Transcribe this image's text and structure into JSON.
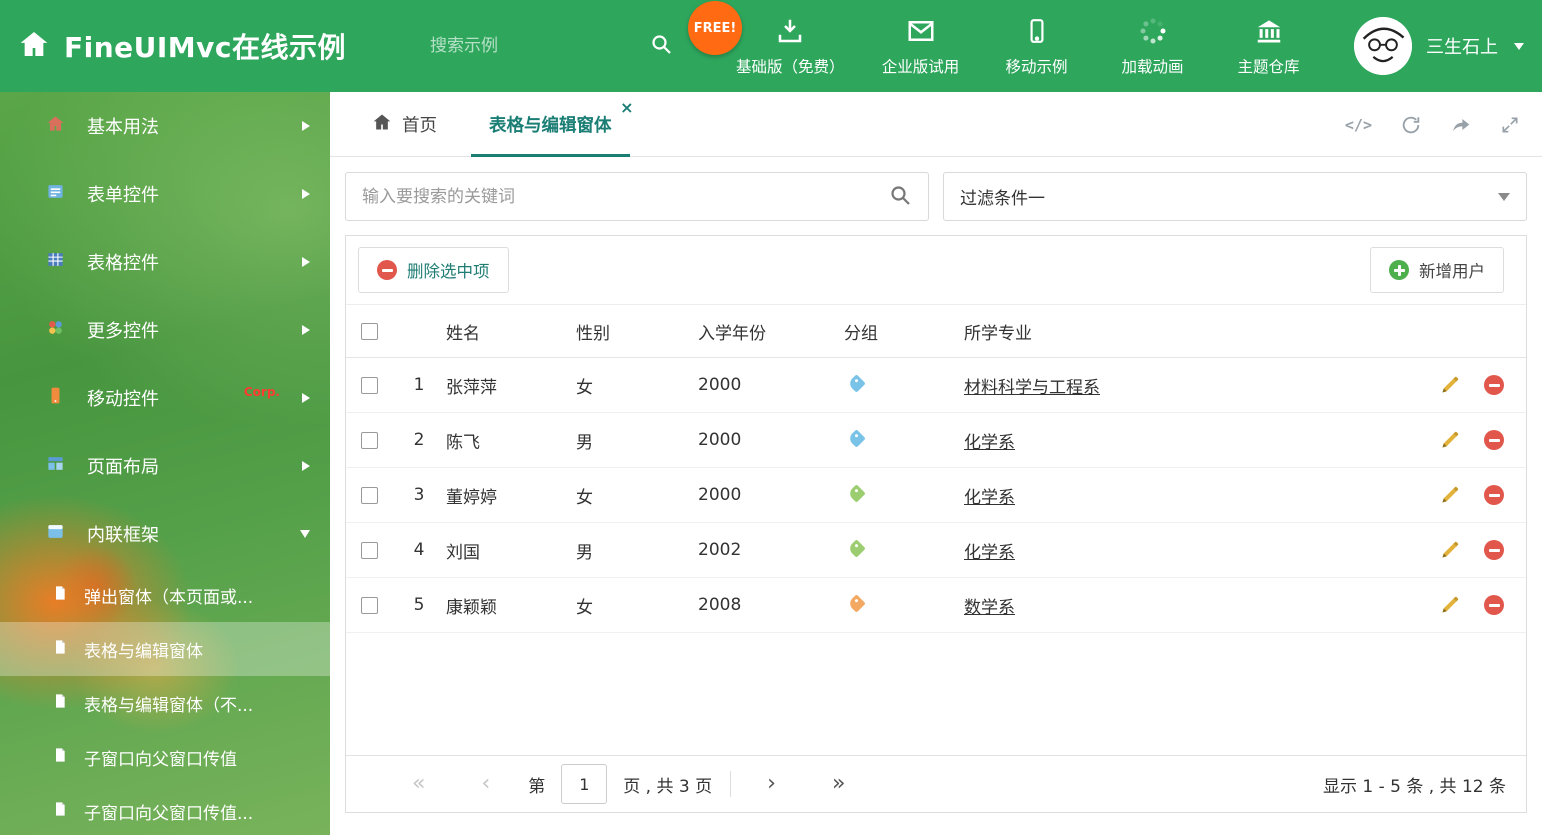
{
  "colors": {
    "header_bg": "#2ea75d",
    "accent_teal": "#1b7e75",
    "free_badge_bg": "#ff6a13",
    "delete_red": "#e2574c",
    "add_green": "#4db04d",
    "edit_yellow": "#e3b23a"
  },
  "header": {
    "title": "FineUIMvc在线示例",
    "search_placeholder": "搜索示例",
    "free_badge": "FREE!",
    "nav_items": [
      {
        "label": "基础版（免费）",
        "icon": "download-icon"
      },
      {
        "label": "企业版试用",
        "icon": "envelope-icon"
      },
      {
        "label": "移动示例",
        "icon": "mobile-icon"
      },
      {
        "label": "加载动画",
        "icon": "spinner-icon"
      },
      {
        "label": "主题仓库",
        "icon": "bank-icon"
      }
    ],
    "user_name": "三生石上"
  },
  "sidebar": {
    "items": [
      {
        "label": "基本用法",
        "icon": "home-icon"
      },
      {
        "label": "表单控件",
        "icon": "form-icon"
      },
      {
        "label": "表格控件",
        "icon": "table-icon"
      },
      {
        "label": "更多控件",
        "icon": "blocks-icon"
      },
      {
        "label": "移动控件",
        "icon": "mobile-icon",
        "badge": "Corp."
      },
      {
        "label": "页面布局",
        "icon": "layout-icon"
      },
      {
        "label": "内联框架",
        "icon": "frame-icon"
      }
    ],
    "submenu": [
      {
        "label": "弹出窗体（本页面或..."
      },
      {
        "label": "表格与编辑窗体"
      },
      {
        "label": "表格与编辑窗体（不..."
      },
      {
        "label": "子窗口向父窗口传值"
      },
      {
        "label": "子窗口向父窗口传值..."
      }
    ]
  },
  "tabs": {
    "home": "首页",
    "active": "表格与编辑窗体",
    "close_glyph": "×"
  },
  "tab_tools": {
    "code_glyph": "</>"
  },
  "filter": {
    "search_placeholder": "输入要搜索的关键词",
    "dropdown_value": "过滤条件一"
  },
  "grid": {
    "delete_button": "删除选中项",
    "add_button": "新增用户",
    "columns": {
      "name": "姓名",
      "gender": "性别",
      "year": "入学年份",
      "group": "分组",
      "major": "所学专业"
    },
    "rows": [
      {
        "index": "1",
        "name": "张萍萍",
        "gender": "女",
        "year": "2000",
        "tag_color": "#79c3e8",
        "major": "材料科学与工程系"
      },
      {
        "index": "2",
        "name": "陈飞",
        "gender": "男",
        "year": "2000",
        "tag_color": "#79c3e8",
        "major": "化学系"
      },
      {
        "index": "3",
        "name": "董婷婷",
        "gender": "女",
        "year": "2000",
        "tag_color": "#9ccd70",
        "major": "化学系"
      },
      {
        "index": "4",
        "name": "刘国",
        "gender": "男",
        "year": "2002",
        "tag_color": "#9ccd70",
        "major": "化学系"
      },
      {
        "index": "5",
        "name": "康颖颖",
        "gender": "女",
        "year": "2008",
        "tag_color": "#f3a963",
        "major": "数学系"
      }
    ],
    "pagination": {
      "first_glyph": "«",
      "prev_glyph": "‹",
      "next_glyph": "›",
      "last_glyph": "»",
      "prefix": "第",
      "current_page": "1",
      "suffix": "页 , 共 3 页",
      "summary": "显示 1 - 5 条 , 共 12 条"
    }
  }
}
